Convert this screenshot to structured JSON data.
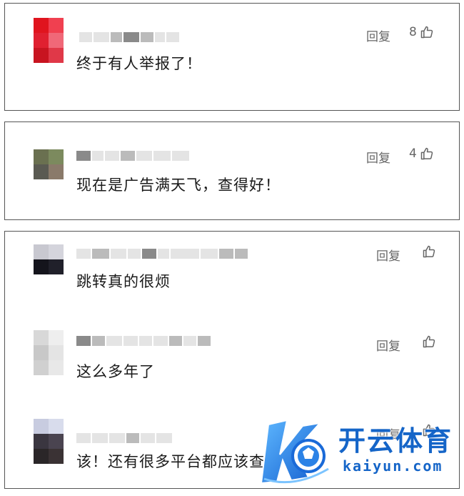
{
  "comments": [
    {
      "text": "终于有人举报了！",
      "reply_label": "回复",
      "likes": "8",
      "avatar_colors": [
        "#e0141e",
        "#f04050",
        "#e02030",
        "#f06878",
        "#c81420",
        "#e03848"
      ]
    },
    {
      "text": "现在是广告满天飞，查得好！",
      "reply_label": "回复",
      "likes": "4",
      "avatar_colors": [
        "#6a7050",
        "#7c8a5e",
        "#5a5a52",
        "#8a7a6a"
      ]
    },
    {
      "text": "跳转真的很烦",
      "reply_label": "回复",
      "likes": "",
      "avatar_colors": [
        "#c8c8d0",
        "#d4d4dc",
        "#14141c",
        "#20202a"
      ]
    },
    {
      "text": "这么多年了",
      "reply_label": "回复",
      "likes": "",
      "avatar_colors": [
        "#d8d8d8",
        "#eeeeee",
        "#c8c8c8",
        "#e4e4e4",
        "#d0d0d0",
        "#e8e8e8"
      ]
    },
    {
      "text": "该！还有很多平台都应该查台一下",
      "reply_label": "回复",
      "likes": "",
      "avatar_colors": [
        "#c8cce0",
        "#d8dcec",
        "#3a3640",
        "#4a4450",
        "#2a2628",
        "#3a3234"
      ]
    }
  ],
  "watermark": {
    "title": "开云体育",
    "url": "kaiyun.com"
  },
  "icons": {
    "like": "thumbs-up-icon"
  }
}
